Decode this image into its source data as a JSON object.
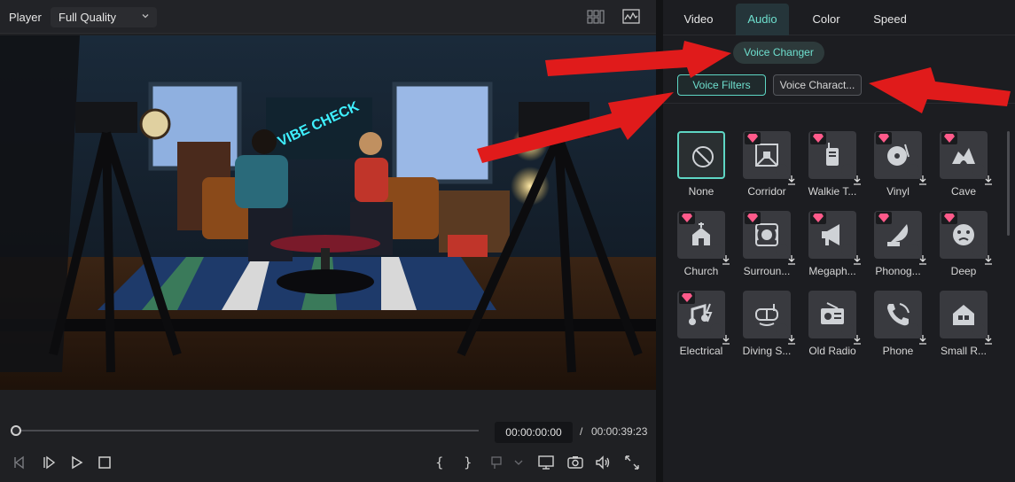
{
  "player": {
    "title": "Player",
    "quality": "Full Quality",
    "current_time": "00:00:00:00",
    "separator": "/",
    "total_time": "00:00:39:23",
    "progress": 0.0
  },
  "video": {
    "neon_sign": "VIBE CHECK"
  },
  "panel": {
    "tabs": [
      {
        "label": "Video"
      },
      {
        "label": "Audio"
      },
      {
        "label": "Color"
      },
      {
        "label": "Speed"
      }
    ],
    "active_tab": "Audio",
    "voice_changer": "Voice Changer",
    "segments": {
      "filters": "Voice Filters",
      "characters": "Voice Charact..."
    },
    "filters": [
      {
        "label": "None",
        "icon": "none-icon",
        "premium": false,
        "selected": true
      },
      {
        "label": "Corridor",
        "icon": "corridor-icon",
        "premium": true
      },
      {
        "label": "Walkie T...",
        "icon": "walkie-talkie-icon",
        "premium": true
      },
      {
        "label": "Vinyl",
        "icon": "vinyl-icon",
        "premium": true
      },
      {
        "label": "Cave",
        "icon": "cave-icon",
        "premium": true
      },
      {
        "label": "Church",
        "icon": "church-icon",
        "premium": true
      },
      {
        "label": "Surroun...",
        "icon": "surround-icon",
        "premium": true
      },
      {
        "label": "Megaph...",
        "icon": "megaphone-icon",
        "premium": true
      },
      {
        "label": "Phonog...",
        "icon": "phonograph-icon",
        "premium": true
      },
      {
        "label": "Deep",
        "icon": "deep-icon",
        "premium": true
      },
      {
        "label": "Electrical",
        "icon": "electrical-icon",
        "premium": true
      },
      {
        "label": "Diving S...",
        "icon": "diving-icon",
        "premium": false
      },
      {
        "label": "Old Radio",
        "icon": "old-radio-icon",
        "premium": false
      },
      {
        "label": "Phone",
        "icon": "phone-icon",
        "premium": false
      },
      {
        "label": "Small R...",
        "icon": "small-room-icon",
        "premium": false
      }
    ]
  },
  "colors": {
    "accent": "#5ed6c4",
    "arrow": "#e01b1b",
    "premium_gem": "#ff5a8a"
  }
}
